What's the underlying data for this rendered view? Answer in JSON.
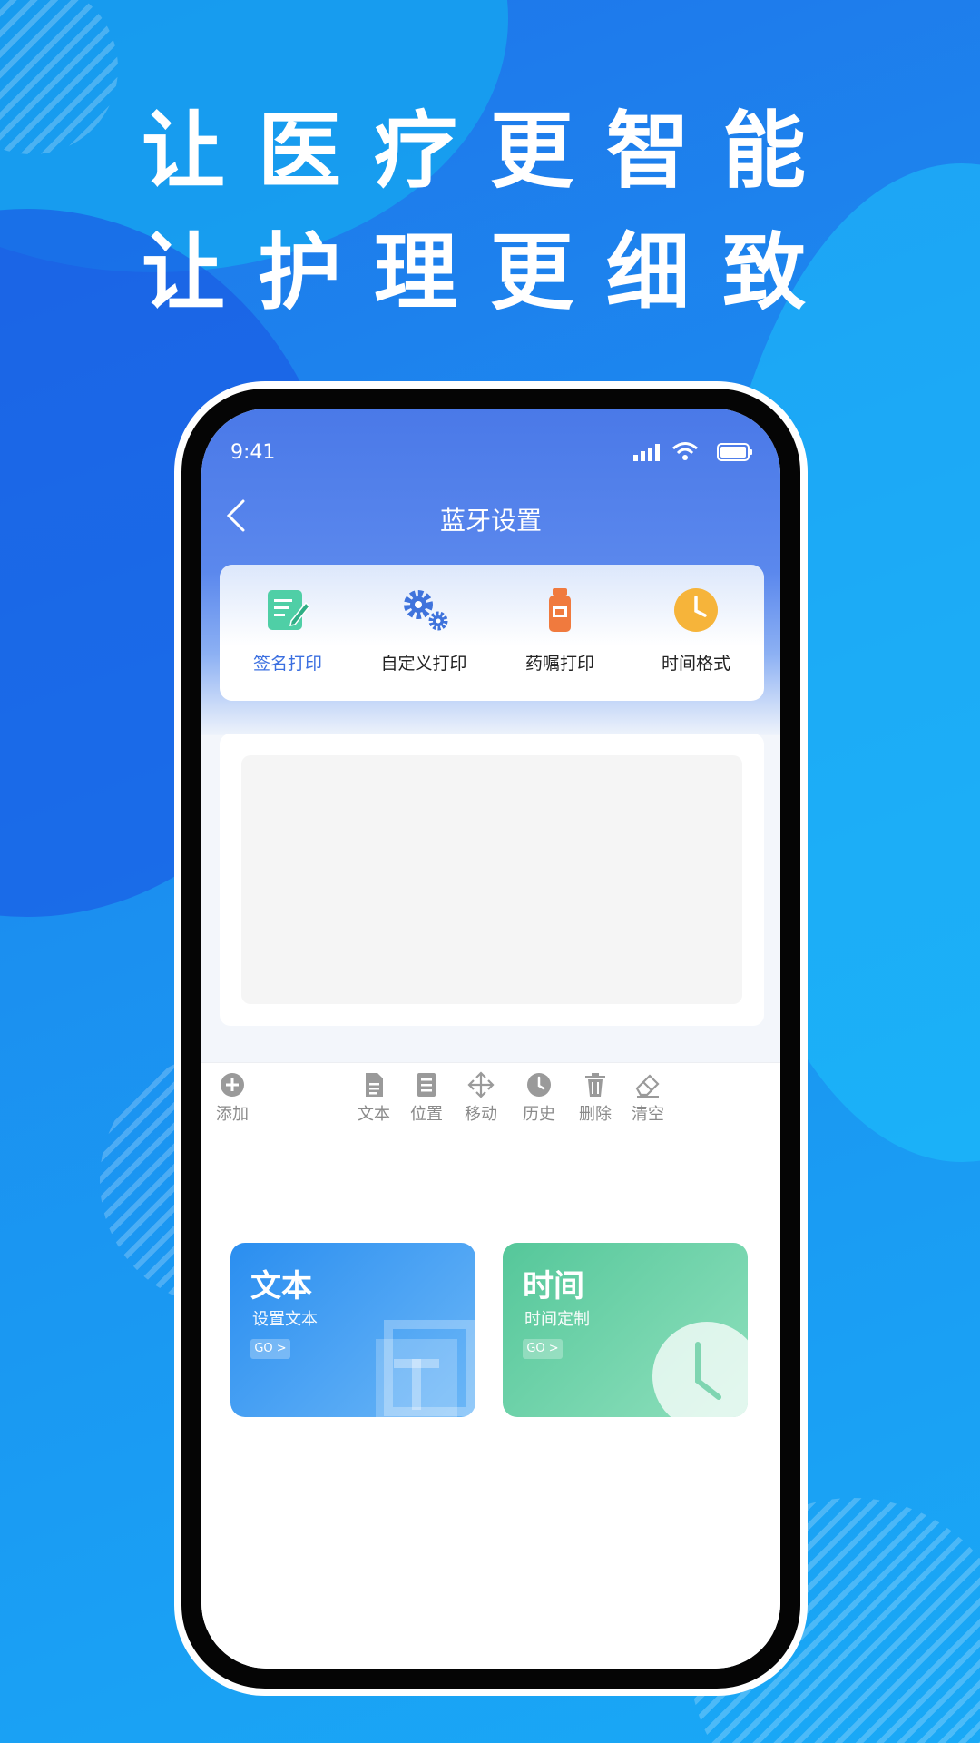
{
  "poster": {
    "headline_1": "让医疗更智能",
    "headline_2": "让护理更细致"
  },
  "status_bar": {
    "time": "9:41"
  },
  "nav": {
    "title": "蓝牙设置"
  },
  "tools": [
    {
      "label": "签名打印",
      "icon": "signature-edit-icon",
      "active": true
    },
    {
      "label": "自定义打印",
      "icon": "gears-icon",
      "active": false
    },
    {
      "label": "药嘱打印",
      "icon": "medicine-bottle-icon",
      "active": false
    },
    {
      "label": "时间格式",
      "icon": "clock-icon",
      "active": false
    }
  ],
  "edit_bar": {
    "add": "添加",
    "text": "文本",
    "position": "位置",
    "move": "移动",
    "history": "历史",
    "delete": "删除",
    "clear": "清空"
  },
  "cards": [
    {
      "title": "文本",
      "subtitle": "设置文本",
      "go": "GO >",
      "color": "#2a8ef0",
      "icon": "text-frame-icon"
    },
    {
      "title": "时间",
      "subtitle": "时间定制",
      "go": "GO >",
      "color": "#55c79a",
      "icon": "clock-icon"
    }
  ],
  "colors": {
    "accent": "#3b6fe0",
    "nav_bg": "#4a79e8",
    "poster_bg": "#1f74ea"
  }
}
